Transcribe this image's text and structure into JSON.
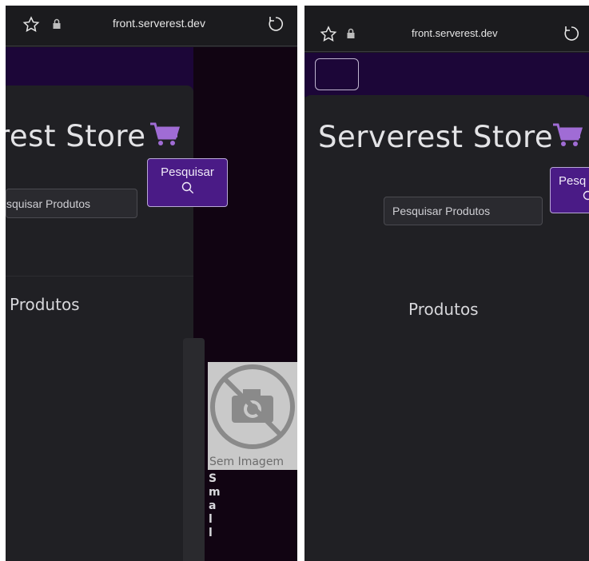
{
  "browser": {
    "url": "front.serverest.dev",
    "star_icon": "star-icon",
    "lock_icon": "lock-icon",
    "reload_icon": "reload-icon"
  },
  "store": {
    "title": "Serverest Store",
    "title_cropped": "rest Store",
    "cart_icon": "cart-icon"
  },
  "search": {
    "button_label": "Pesquisar",
    "button_label_cropped": "Pesq",
    "placeholder": "Pesquisar Produtos",
    "placeholder_cropped": "squisar Produtos"
  },
  "products": {
    "section_title": "Produtos",
    "no_image_label": "Sem Imagem",
    "product_name_letters": [
      "S",
      "m",
      "a",
      "l",
      "l"
    ]
  },
  "colors": {
    "accent_purple": "#4a1b86",
    "band_purple": "#1c0638",
    "cart_purple": "#a06cd5",
    "card_bg": "#202024"
  }
}
